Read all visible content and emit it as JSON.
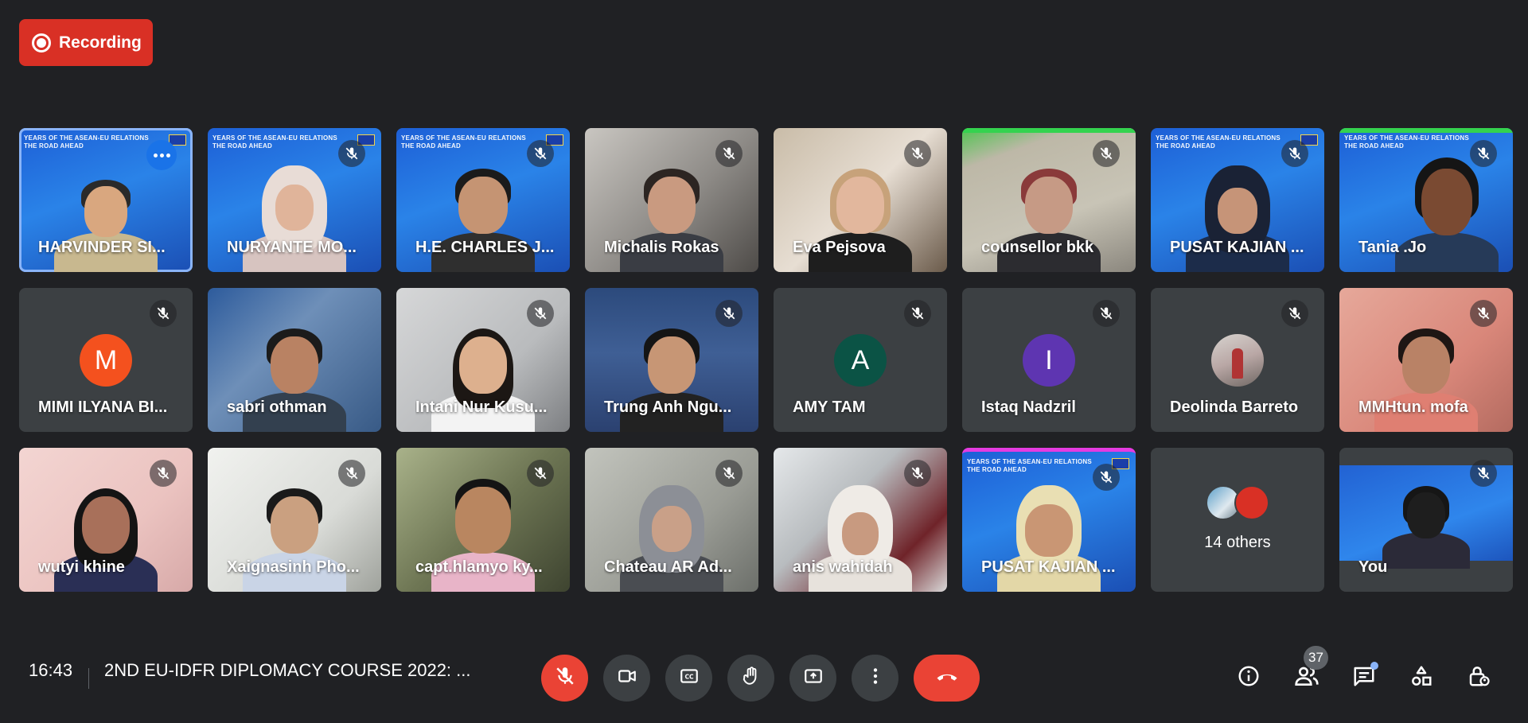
{
  "recording": {
    "label": "Recording"
  },
  "tiles": [
    {
      "name": "HARVINDER SI...",
      "muted": false,
      "more_menu": true
    },
    {
      "name": "NURYANTE MO...",
      "muted": true
    },
    {
      "name": "H.E. CHARLES J...",
      "muted": true
    },
    {
      "name": "Michalis Rokas",
      "muted": true
    },
    {
      "name": "Eva Pejsova",
      "muted": true
    },
    {
      "name": "counsellor bkk",
      "muted": true
    },
    {
      "name": "PUSAT KAJIAN ...",
      "muted": true
    },
    {
      "name": "Tania .Jo",
      "muted": true
    },
    {
      "name": "MIMI ILYANA BI...",
      "muted": true,
      "avatar_letter": "M",
      "avatar_color": "#f4511e"
    },
    {
      "name": "sabri othman",
      "muted": false
    },
    {
      "name": "Intani Nur Kusu...",
      "muted": true
    },
    {
      "name": "Trung Anh Ngu...",
      "muted": true
    },
    {
      "name": "AMY TAM",
      "muted": true,
      "avatar_letter": "A",
      "avatar_color": "#0b5345"
    },
    {
      "name": "Istaq Nadzril",
      "muted": true,
      "avatar_letter": "I",
      "avatar_color": "#5e35b1"
    },
    {
      "name": "Deolinda Barreto",
      "muted": true
    },
    {
      "name": "MMHtun. mofa",
      "muted": true
    },
    {
      "name": "wutyi khine",
      "muted": true
    },
    {
      "name": "Xaignasinh Pho...",
      "muted": true
    },
    {
      "name": "capt.hlamyo ky...",
      "muted": true
    },
    {
      "name": "Chateau AR Ad...",
      "muted": true
    },
    {
      "name": "anis wahidah",
      "muted": true
    },
    {
      "name": "PUSAT KAJIAN ...",
      "muted": true
    },
    {
      "name": "",
      "others_label": "14 others"
    },
    {
      "name": "You",
      "muted": true
    }
  ],
  "banner": {
    "line1": "YEARS OF THE ASEAN-EU RELATIONS",
    "line2": "THE ROAD AHEAD"
  },
  "bottom_bar": {
    "time": "16:43",
    "meeting_title": "2ND EU-IDFR DIPLOMACY COURSE 2022: ...",
    "participant_count": "37",
    "colors": {
      "danger": "#ea4335",
      "control_bg": "#3c4043",
      "accent": "#8ab4f8"
    }
  },
  "icons": {
    "recording": "record-icon",
    "mic_off": "mic-off-icon",
    "camera": "camera-icon",
    "captions": "captions-icon",
    "raise_hand": "raise-hand-icon",
    "present": "present-screen-icon",
    "more": "more-vert-icon",
    "hangup": "phone-hangup-icon",
    "info": "info-icon",
    "people": "people-icon",
    "chat": "chat-icon",
    "activities": "activities-icon",
    "host_controls": "lock-person-icon"
  }
}
